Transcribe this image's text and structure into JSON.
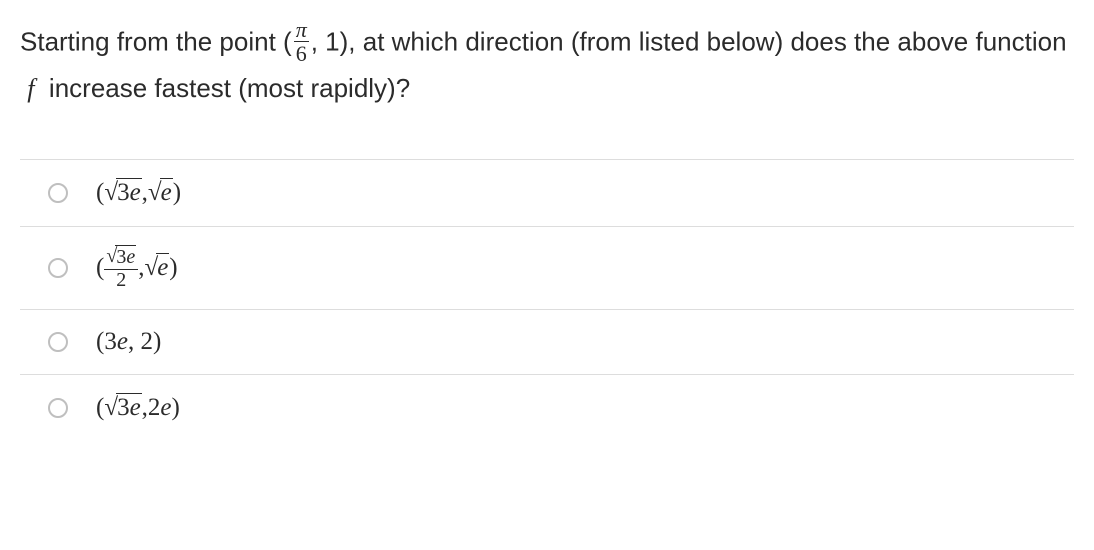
{
  "question": {
    "pre": "Starting from the point (",
    "frac_num": "π",
    "frac_den": "6",
    "mid1": ", 1), at which direction  (from listed below) does the above function ",
    "func": "f",
    "post": " increase fastest (most rapidly)?"
  },
  "options": [
    {
      "type": "expr1",
      "lp": "(",
      "a_pre_sqrt": "",
      "a_rad": "3e",
      "comma": ", ",
      "b_rad": "e",
      "rp": ")"
    },
    {
      "type": "expr2",
      "lp": "(",
      "num_rad": "3e",
      "den": "2",
      "comma": ", ",
      "b_rad": "e",
      "rp": ")"
    },
    {
      "type": "plain",
      "text": "(3e, 2)",
      "a": "3e",
      "b": "2"
    },
    {
      "type": "expr3",
      "lp": "(",
      "a_rad": "3e",
      "comma": ", ",
      "b": "2e",
      "rp": ")"
    }
  ]
}
